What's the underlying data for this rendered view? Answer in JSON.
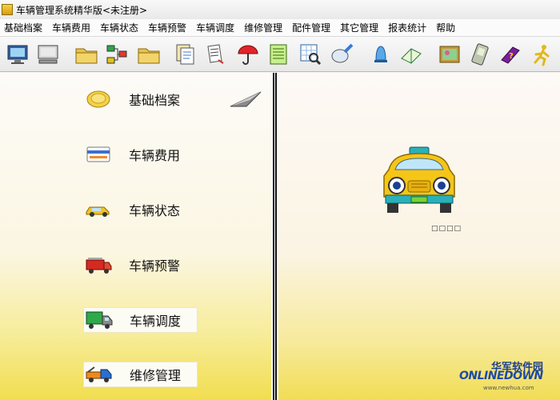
{
  "window": {
    "title": "车辆管理系统精华版<未注册>"
  },
  "menu": [
    "基础档案",
    "车辆费用",
    "车辆状态",
    "车辆预警",
    "车辆调度",
    "维修管理",
    "配件管理",
    "其它管理",
    "报表统计",
    "帮助"
  ],
  "toolbar": [
    {
      "icon": "monitor-icon"
    },
    {
      "icon": "screen-icon"
    },
    {
      "icon": "folder-icon"
    },
    {
      "icon": "network-icon"
    },
    {
      "icon": "folder-icon"
    },
    {
      "icon": "files-icon"
    },
    {
      "icon": "documents-icon"
    },
    {
      "icon": "umbrella-icon"
    },
    {
      "icon": "notebook-icon"
    },
    {
      "icon": "magnifier-grid-icon"
    },
    {
      "icon": "search-icon"
    },
    {
      "icon": "bell-icon"
    },
    {
      "icon": "book-icon"
    },
    {
      "icon": "picture-icon"
    },
    {
      "icon": "handheld-icon"
    },
    {
      "icon": "help-book-icon"
    },
    {
      "icon": "exit-icon"
    }
  ],
  "nav": [
    {
      "label": "基础档案",
      "icon": "coin-icon"
    },
    {
      "label": "车辆费用",
      "icon": "card-icon"
    },
    {
      "label": "车辆状态",
      "icon": "car-icon"
    },
    {
      "label": "车辆预警",
      "icon": "fire-truck-icon"
    },
    {
      "label": "车辆调度",
      "icon": "green-truck-icon"
    },
    {
      "label": "维修管理",
      "icon": "tow-truck-icon"
    }
  ],
  "taxi_caption": "□□□□",
  "watermark": {
    "cn": "华军软件园",
    "en": "ONLINEDOWN",
    "url": "www.newhua.com"
  },
  "colors": {
    "panel_yellow": "#f1de4f",
    "taxi_yellow": "#f5c518",
    "watermark_blue": "#1d4aa8"
  }
}
